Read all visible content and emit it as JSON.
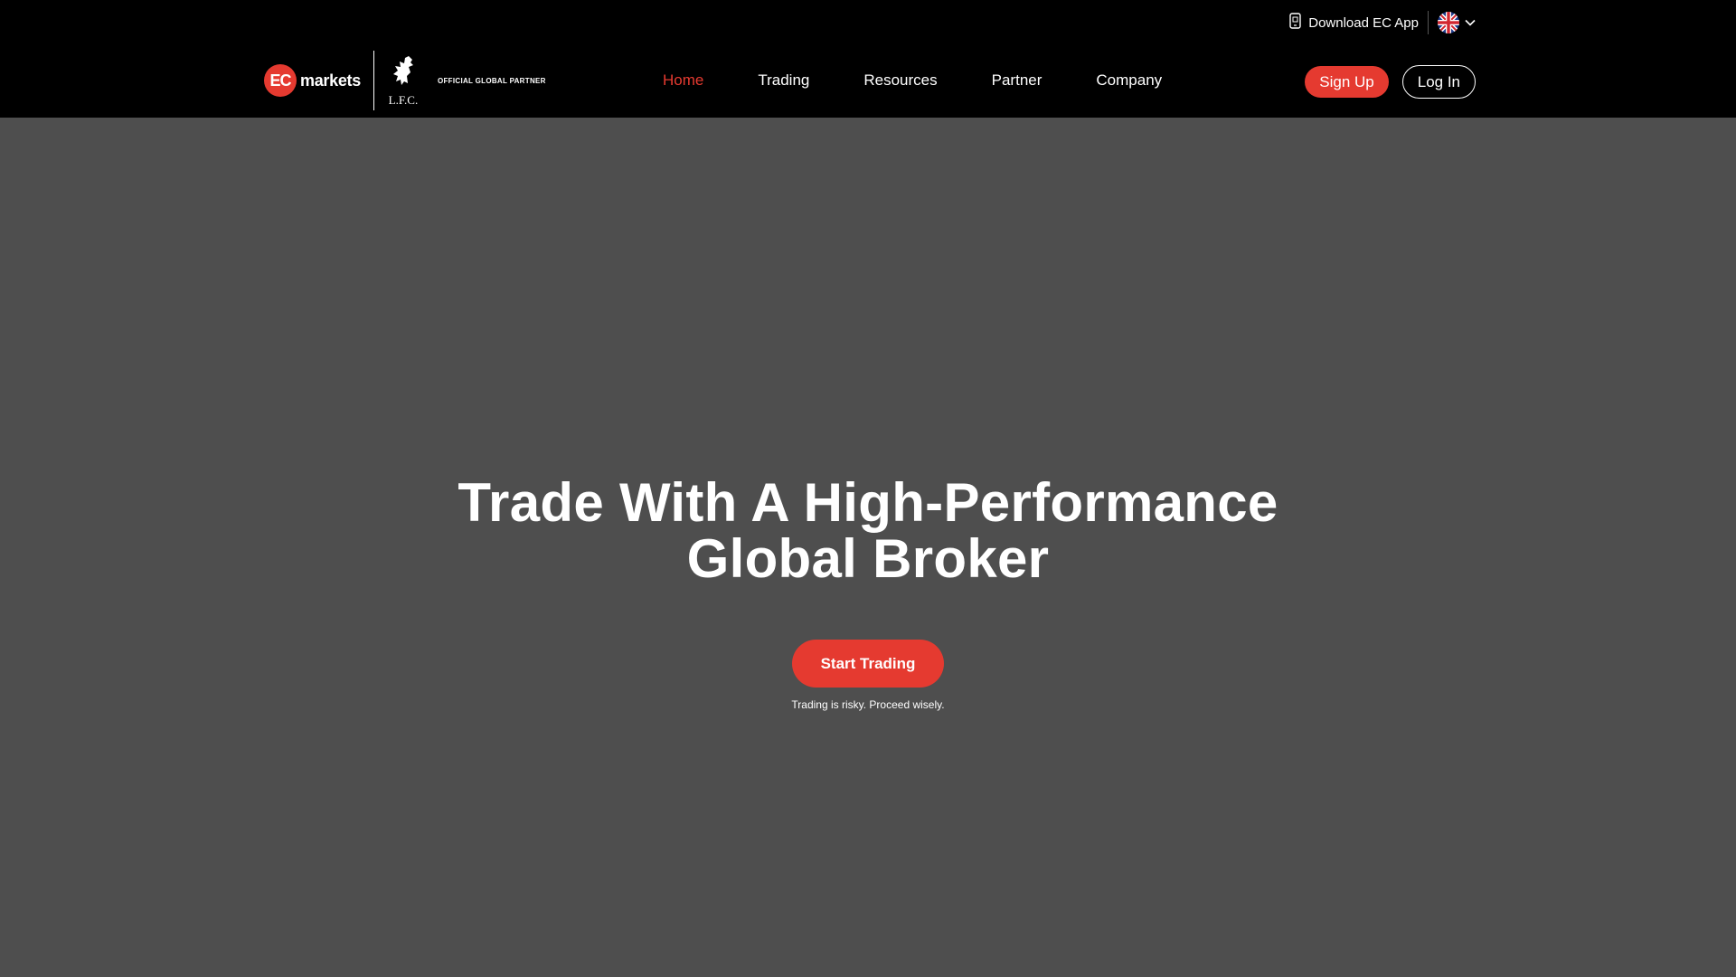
{
  "topbar": {
    "download_label": "Download EC App",
    "language_icon": "uk-flag-icon"
  },
  "brand": {
    "ec_badge": "EC",
    "ec_word": "markets",
    "lfc_text": "L.F.C.",
    "partner_text": "OFFICIAL GLOBAL PARTNER"
  },
  "nav": {
    "items": [
      {
        "label": "Home",
        "active": true
      },
      {
        "label": "Trading"
      },
      {
        "label": "Resources"
      },
      {
        "label": "Partner"
      },
      {
        "label": "Company"
      }
    ]
  },
  "auth": {
    "signup_label": "Sign Up",
    "login_label": "Log In"
  },
  "hero": {
    "title_line1": "Trade With A High-Performance",
    "title_line2": "Global Broker",
    "cta_label": "Start Trading",
    "risk_note": "Trading is risky. Proceed wisely."
  },
  "colors": {
    "brand_red": "#e53a30",
    "header_bg": "#000000",
    "hero_bg": "#4e4e4e"
  }
}
